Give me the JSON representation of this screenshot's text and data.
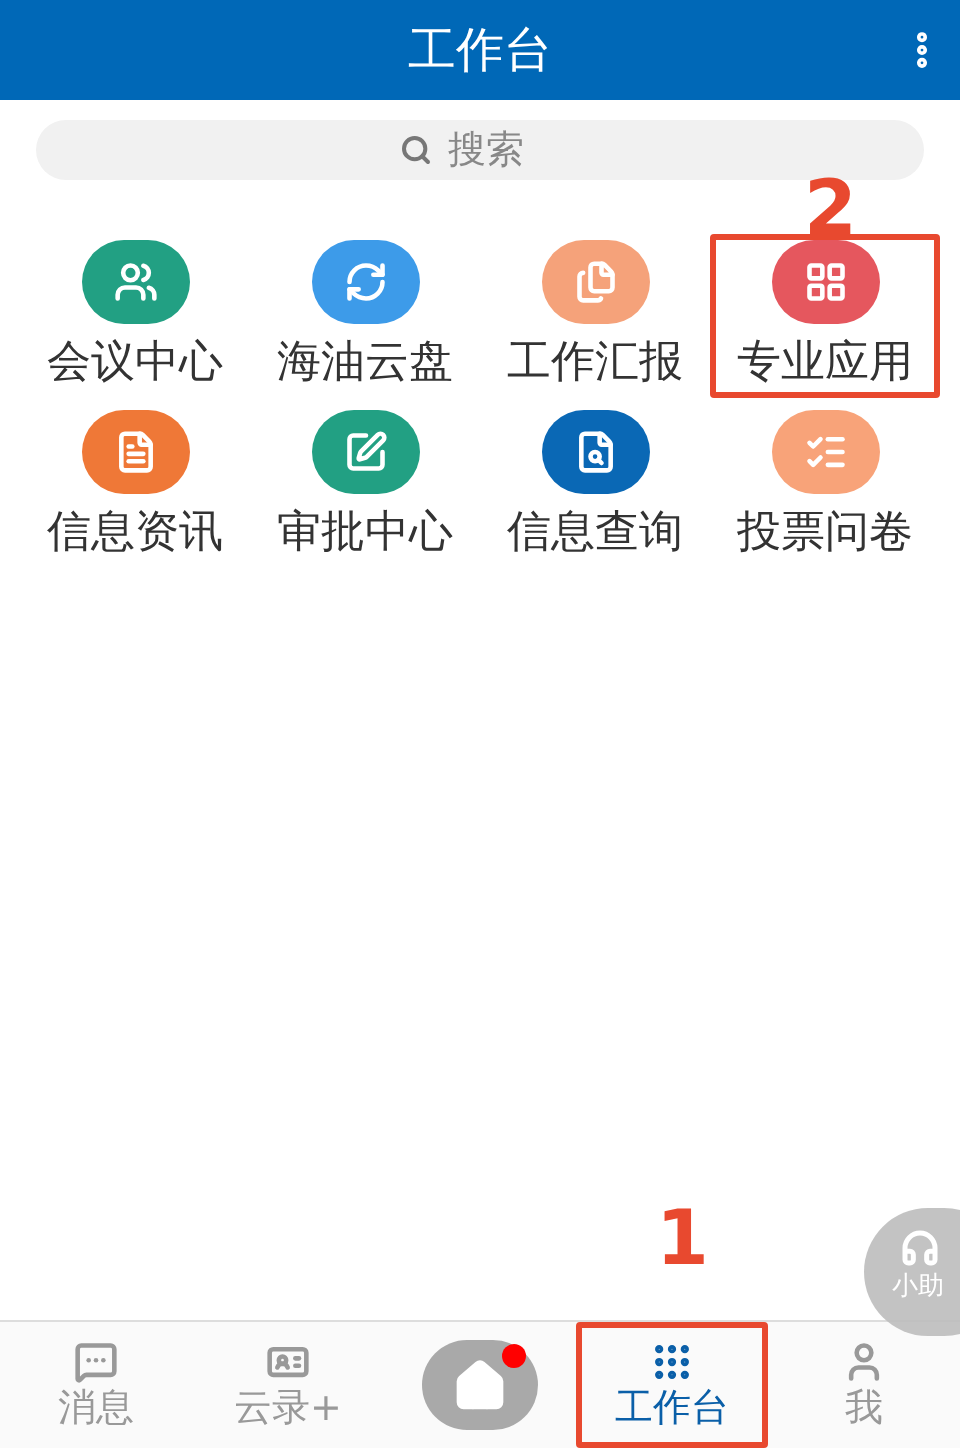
{
  "header": {
    "title": "工作台"
  },
  "search": {
    "placeholder": "搜索"
  },
  "apps": [
    {
      "label": "会议中心",
      "kind": "meeting",
      "color": "#22a083",
      "highlighted": false
    },
    {
      "label": "海油云盘",
      "kind": "cloud",
      "color": "#3d9be9",
      "highlighted": false
    },
    {
      "label": "工作汇报",
      "kind": "report",
      "color": "#f5a27a",
      "highlighted": false
    },
    {
      "label": "专业应用",
      "kind": "grid",
      "color": "#e5575e",
      "highlighted": true
    },
    {
      "label": "信息资讯",
      "kind": "document",
      "color": "#ef7837",
      "highlighted": false
    },
    {
      "label": "审批中心",
      "kind": "approve",
      "color": "#22a083",
      "highlighted": false
    },
    {
      "label": "信息查询",
      "kind": "query",
      "color": "#0a68b5",
      "highlighted": false
    },
    {
      "label": "投票问卷",
      "kind": "vote",
      "color": "#f8a379",
      "highlighted": false
    }
  ],
  "nav": [
    {
      "label": "消息",
      "kind": "messages",
      "selected": false,
      "highlighted": false
    },
    {
      "label": "云录+",
      "kind": "card",
      "selected": false,
      "highlighted": false
    },
    {
      "kind": "home",
      "selected": false,
      "dot": true,
      "highlighted": false
    },
    {
      "label": "工作台",
      "kind": "workbench",
      "selected": true,
      "highlighted": true
    },
    {
      "label": "我",
      "kind": "me",
      "selected": false,
      "highlighted": false
    }
  ],
  "assistant": {
    "label": "小助"
  },
  "annotations": [
    {
      "number": "2"
    },
    {
      "number": "1"
    }
  ]
}
